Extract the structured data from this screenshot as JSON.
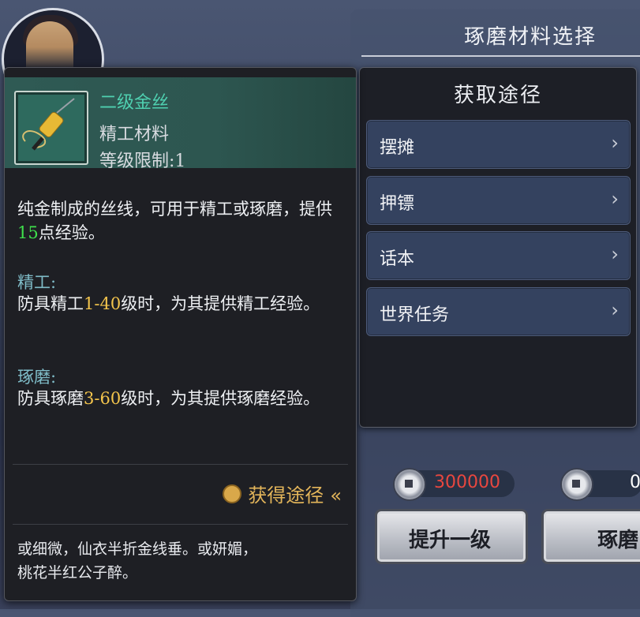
{
  "right_panel": {
    "title": "琢磨材料选择"
  },
  "source_panel": {
    "title": "获取途径",
    "items": [
      {
        "label": "摆摊",
        "chevron": "›"
      },
      {
        "label": "押镖",
        "chevron": "›"
      },
      {
        "label": "话本",
        "chevron": "›"
      },
      {
        "label": "世界任务",
        "chevron": "›"
      }
    ]
  },
  "currency": [
    {
      "icon": "coin-icon",
      "value": "300000",
      "color": "#e8473f"
    },
    {
      "icon": "coin-icon",
      "value": "0",
      "color": "#ffffff"
    }
  ],
  "buttons": {
    "upgrade_one": "提升一级",
    "polish": "琢磨"
  },
  "item": {
    "name": "二级金丝",
    "type": "精工材料",
    "level_limit": "等级限制:1",
    "desc_a": "纯金制成的丝线，可用于精工或琢磨，提供",
    "desc_exp": "15",
    "desc_b": "点经验。",
    "craft_title": "精工:",
    "craft_a": "防具精工",
    "craft_range": "1-40",
    "craft_b": "级时，为其提供精工经验。",
    "polish_title": "琢磨:",
    "polish_a": "防具琢磨",
    "polish_range": "3-60",
    "polish_b": "级时，为其提供琢磨经验。",
    "get_way": "获得途径",
    "get_way_arrow": "«",
    "poem_line1": "或细微，仙衣半折金线垂。或妍媚，",
    "poem_line2": "桃花半红公子醉。"
  }
}
